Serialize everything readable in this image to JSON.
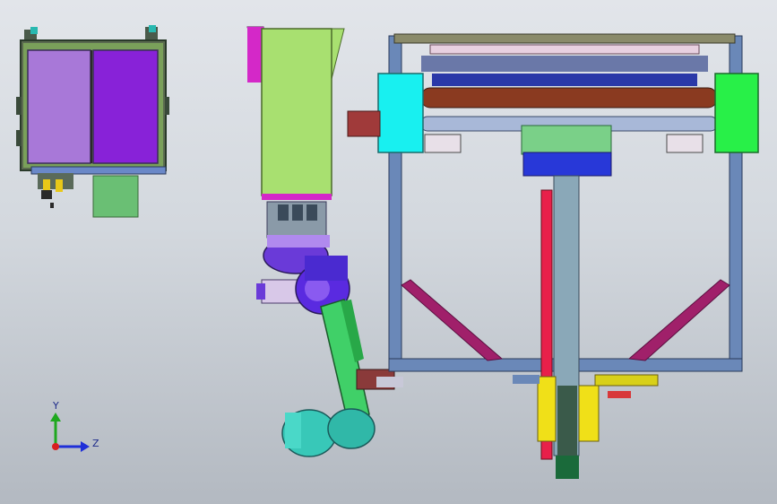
{
  "viewport": {
    "background_top": "#e2e5ea",
    "background_bottom": "#b3b9c1"
  },
  "triad": {
    "y_label": "Y",
    "z_label": "Z",
    "y_color": "#1fa81f",
    "z_color": "#1f2fd8",
    "x_color": "#d81f1f"
  },
  "colors": {
    "cabinet_frame": "#3a4a3a",
    "cabinet_panel_left": "#a878d8",
    "cabinet_panel_right": "#8822d8",
    "hopper_green": "#a8e070",
    "hopper_magenta": "#d428c8",
    "robot_purple": "#6a3ad8",
    "robot_green": "#40d068",
    "robot_teal": "#38c8b8",
    "frame_blue": "#6a88b8",
    "brace_magenta": "#a0206a",
    "cyan_block": "#18f0f0",
    "green_block": "#28f048",
    "roller_brown": "#8a3a20",
    "blue_motor": "#2838d8",
    "red_rail": "#e8204a",
    "yellow_plate": "#f0e018"
  }
}
